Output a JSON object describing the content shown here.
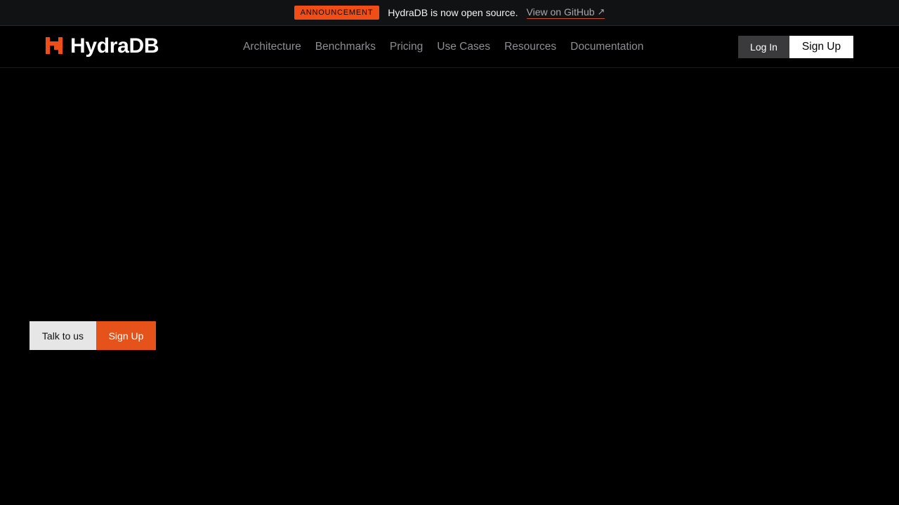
{
  "announcement": {
    "badge": "ANNOUNCEMENT",
    "text": "HydraDB is now open source.",
    "link_label": "View on GitHub",
    "link_icon": "external-arrow-icon"
  },
  "brand": {
    "name": "HydraDB",
    "logo_icon": "hydradb-logo-icon",
    "accent_color": "#f04e16"
  },
  "nav": {
    "links": [
      {
        "label": "Architecture"
      },
      {
        "label": "Benchmarks"
      },
      {
        "label": "Pricing"
      },
      {
        "label": "Use Cases"
      },
      {
        "label": "Resources"
      },
      {
        "label": "Documentation"
      }
    ]
  },
  "auth": {
    "login_label": "Log In",
    "signup_label": "Sign Up"
  },
  "cta": {
    "talk_label": "Talk to us",
    "signup_label": "Sign Up"
  }
}
